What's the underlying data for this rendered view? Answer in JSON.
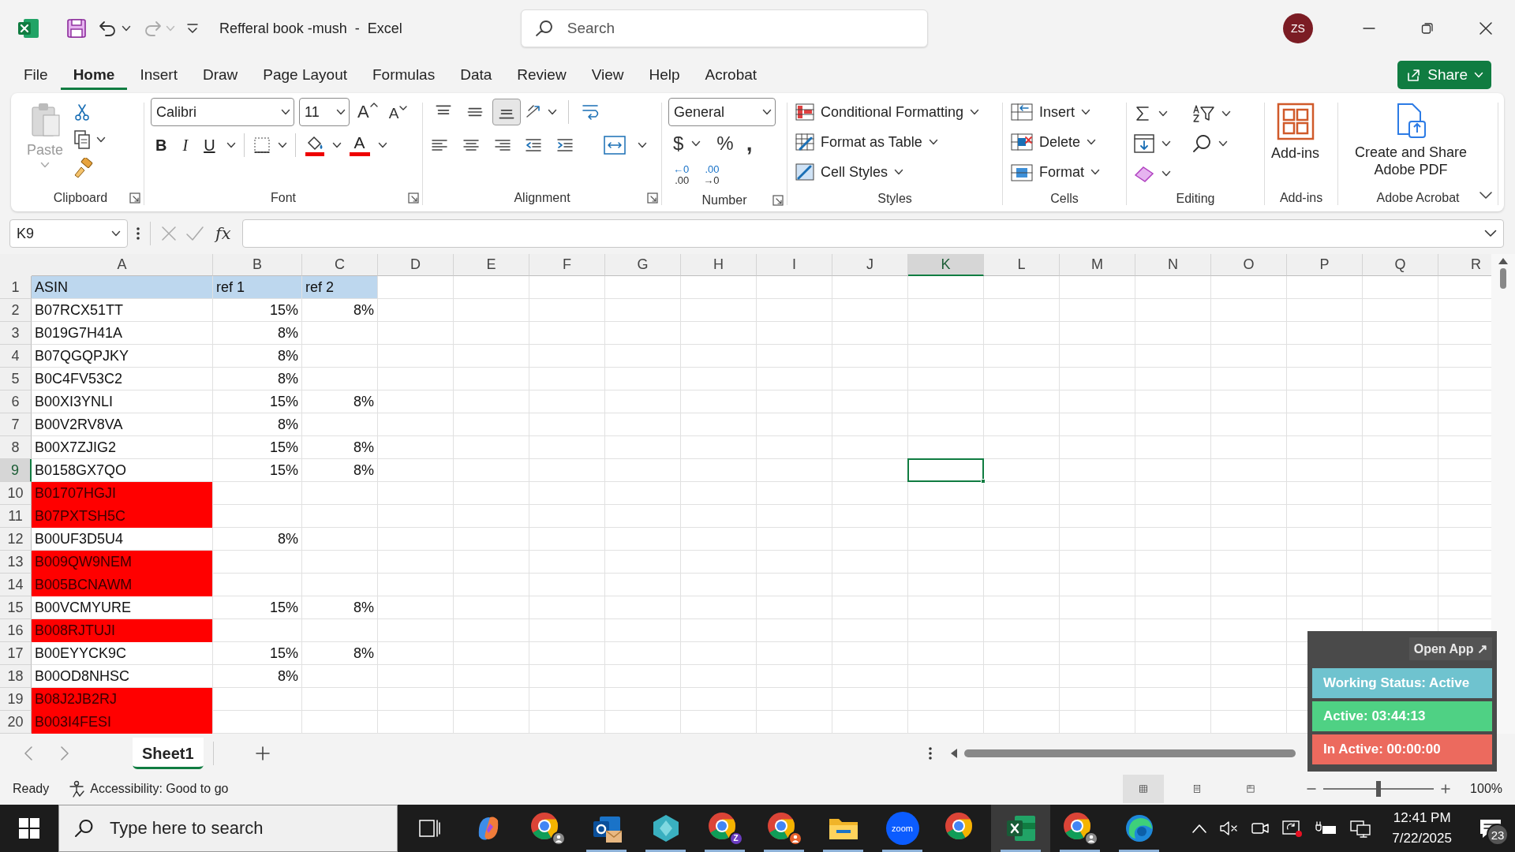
{
  "title_bar": {
    "document_title": "Refferal book -mush  -  Excel",
    "search": {
      "placeholder": "Search"
    },
    "avatar": "ZS"
  },
  "tabs": [
    {
      "label": "File",
      "selected": false
    },
    {
      "label": "Home",
      "selected": true
    },
    {
      "label": "Insert",
      "selected": false
    },
    {
      "label": "Draw",
      "selected": false
    },
    {
      "label": "Page Layout",
      "selected": false
    },
    {
      "label": "Formulas",
      "selected": false
    },
    {
      "label": "Data",
      "selected": false
    },
    {
      "label": "Review",
      "selected": false
    },
    {
      "label": "View",
      "selected": false
    },
    {
      "label": "Help",
      "selected": false
    },
    {
      "label": "Acrobat",
      "selected": false
    }
  ],
  "share_button": "Share",
  "ribbon": {
    "groups": [
      {
        "kind": "clipboard",
        "label": "Clipboard",
        "launcher": true,
        "paste": {
          "label": "Paste",
          "disabled": true
        }
      },
      {
        "kind": "font",
        "label": "Font",
        "launcher": true,
        "font": "Calibri",
        "size": "11",
        "grow": "A",
        "shrink": "A",
        "bold": "B",
        "italic": "I",
        "underline": "U",
        "font_color": "A"
      },
      {
        "kind": "alignment",
        "label": "Alignment",
        "launcher": true,
        "buttons": [
          {
            "kind": "top",
            "selected": false
          },
          {
            "kind": "middle",
            "selected": false
          },
          {
            "kind": "bottom",
            "selected": true
          }
        ]
      },
      {
        "kind": "number",
        "label": "Number",
        "launcher": true,
        "format": "General",
        "currency": "$",
        "percent": "%",
        "comma": ",",
        "decimals": [
          {
            "top": "←0",
            "bottom": ".00"
          },
          {
            "top": ".00",
            "bottom": "→0"
          }
        ]
      },
      {
        "kind": "styles",
        "label": "Styles",
        "items": [
          {
            "kind": "conditional",
            "label": "Conditional Formatting"
          },
          {
            "kind": "table",
            "label": "Format as Table"
          },
          {
            "kind": "cell_styles",
            "label": "Cell Styles"
          }
        ]
      },
      {
        "kind": "cells",
        "label": "Cells",
        "items": [
          {
            "kind": "insert",
            "label": "Insert"
          },
          {
            "kind": "delete",
            "label": "Delete"
          },
          {
            "kind": "format",
            "label": "Format"
          }
        ]
      },
      {
        "kind": "editing",
        "label": "Editing"
      },
      {
        "kind": "addins",
        "label": "Add-ins",
        "button": "Add-ins"
      },
      {
        "kind": "acrobat",
        "label": "Adobe Acrobat",
        "button": "Create and Share Adobe PDF"
      }
    ]
  },
  "formula_bar": {
    "name_box": "K9",
    "function_label": "fx"
  },
  "columns": [
    {
      "label": "A",
      "selected": false
    },
    {
      "label": "B",
      "selected": false
    },
    {
      "label": "C",
      "selected": false
    },
    {
      "label": "D",
      "selected": false
    },
    {
      "label": "E",
      "selected": false
    },
    {
      "label": "F",
      "selected": false
    },
    {
      "label": "G",
      "selected": false
    },
    {
      "label": "H",
      "selected": false
    },
    {
      "label": "I",
      "selected": false
    },
    {
      "label": "J",
      "selected": false
    },
    {
      "label": "K",
      "selected": true
    },
    {
      "label": "L",
      "selected": false
    },
    {
      "label": "M",
      "selected": false
    },
    {
      "label": "N",
      "selected": false
    },
    {
      "label": "O",
      "selected": false
    },
    {
      "label": "P",
      "selected": false
    },
    {
      "label": "Q",
      "selected": false
    },
    {
      "label": "R",
      "selected": false
    }
  ],
  "rows": [
    {
      "number": "1",
      "selected": false,
      "kind": "header",
      "cells": {
        "a": "ASIN",
        "b": "ref 1",
        "c": "ref 2"
      }
    },
    {
      "number": "2",
      "selected": false,
      "kind": "data",
      "highlight": false,
      "cells": {
        "a": "B07RCX51TT",
        "b": "15%",
        "c": "8%"
      }
    },
    {
      "number": "3",
      "selected": false,
      "kind": "data",
      "highlight": false,
      "cells": {
        "a": "B019G7H41A",
        "b": "8%"
      }
    },
    {
      "number": "4",
      "selected": false,
      "kind": "data",
      "highlight": false,
      "cells": {
        "a": "B07QGQPJKY",
        "b": "8%"
      }
    },
    {
      "number": "5",
      "selected": false,
      "kind": "data",
      "highlight": false,
      "cells": {
        "a": "B0C4FV53C2",
        "b": "8%"
      }
    },
    {
      "number": "6",
      "selected": false,
      "kind": "data",
      "highlight": false,
      "cells": {
        "a": "B00XI3YNLI",
        "b": "15%",
        "c": "8%"
      }
    },
    {
      "number": "7",
      "selected": false,
      "kind": "data",
      "highlight": false,
      "cells": {
        "a": "B00V2RV8VA",
        "b": "8%"
      }
    },
    {
      "number": "8",
      "selected": false,
      "kind": "data",
      "highlight": false,
      "cells": {
        "a": "B00X7ZJIG2",
        "b": "15%",
        "c": "8%"
      }
    },
    {
      "number": "9",
      "selected": true,
      "kind": "data",
      "highlight": false,
      "cells": {
        "a": "B0158GX7QO",
        "b": "15%",
        "c": "8%"
      }
    },
    {
      "number": "10",
      "selected": false,
      "kind": "data",
      "highlight": true,
      "cells": {
        "a": "B01707HGJI"
      }
    },
    {
      "number": "11",
      "selected": false,
      "kind": "data",
      "highlight": true,
      "cells": {
        "a": "B07PXTSH5C"
      }
    },
    {
      "number": "12",
      "selected": false,
      "kind": "data",
      "highlight": false,
      "cells": {
        "a": "B00UF3D5U4",
        "b": "8%"
      }
    },
    {
      "number": "13",
      "selected": false,
      "kind": "data",
      "highlight": true,
      "cells": {
        "a": "B009QW9NEM"
      }
    },
    {
      "number": "14",
      "selected": false,
      "kind": "data",
      "highlight": true,
      "cells": {
        "a": "B005BCNAWM"
      }
    },
    {
      "number": "15",
      "selected": false,
      "kind": "data",
      "highlight": false,
      "cells": {
        "a": "B00VCMYURE",
        "b": "15%",
        "c": "8%"
      }
    },
    {
      "number": "16",
      "selected": false,
      "kind": "data",
      "highlight": true,
      "cells": {
        "a": "B008RJTUJI"
      }
    },
    {
      "number": "17",
      "selected": false,
      "kind": "data",
      "highlight": false,
      "cells": {
        "a": "B00EYYCK9C",
        "b": "15%",
        "c": "8%"
      }
    },
    {
      "number": "18",
      "selected": false,
      "kind": "data",
      "highlight": false,
      "cells": {
        "a": "B00OD8NHSC",
        "b": "8%"
      }
    },
    {
      "number": "19",
      "selected": false,
      "kind": "data",
      "highlight": true,
      "cells": {
        "a": "B08J2JB2RJ"
      }
    },
    {
      "number": "20",
      "selected": false,
      "kind": "data",
      "highlight": true,
      "cells": {
        "a": "B003I4FESI"
      }
    }
  ],
  "sheet_tabs": [
    {
      "label": "Sheet1",
      "selected": true
    }
  ],
  "status_bar": {
    "status": "Ready",
    "accessibility": "Accessibility: Good to go",
    "views": [
      {
        "kind": "normal",
        "selected": true
      },
      {
        "kind": "page_layout",
        "selected": false
      },
      {
        "kind": "page_break",
        "selected": false
      }
    ],
    "zoom_slider": {
      "level": 0.5
    },
    "zoom": "100%"
  },
  "time_tracker": {
    "open_app": "Open App ↗",
    "working_status": "Working Status: Active",
    "active": "Active: 03:44:13",
    "inactive": "In Active: 00:00:00"
  },
  "taskbar": {
    "search": {
      "placeholder": "Type here to search"
    },
    "apps": [
      {
        "kind": "task_view",
        "running": false,
        "selected": false
      },
      {
        "kind": "copilot",
        "running": false,
        "selected": false
      },
      {
        "kind": "chrome",
        "color": "#8a8a8a",
        "running": false,
        "selected": false
      },
      {
        "kind": "outlook",
        "running": true,
        "selected": false
      },
      {
        "kind": "diamond",
        "running": true,
        "selected": false
      },
      {
        "kind": "chrome",
        "color": "#6a3cc0",
        "badge": "Z",
        "running": true,
        "selected": false
      },
      {
        "kind": "chrome",
        "color": "#e8612c",
        "running": true,
        "selected": false
      },
      {
        "kind": "explorer",
        "running": true,
        "selected": false
      },
      {
        "kind": "zoom",
        "label": "zoom",
        "running": true,
        "selected": false
      },
      {
        "kind": "chrome",
        "running": false,
        "selected": false
      },
      {
        "kind": "excel",
        "running": true,
        "selected": true
      },
      {
        "kind": "chrome",
        "color": "#8a8a8a",
        "running": true,
        "selected": false
      },
      {
        "kind": "edge",
        "running": true,
        "selected": false
      }
    ],
    "time": "12:41 PM",
    "date": "7/22/2025",
    "notifications": "23"
  }
}
